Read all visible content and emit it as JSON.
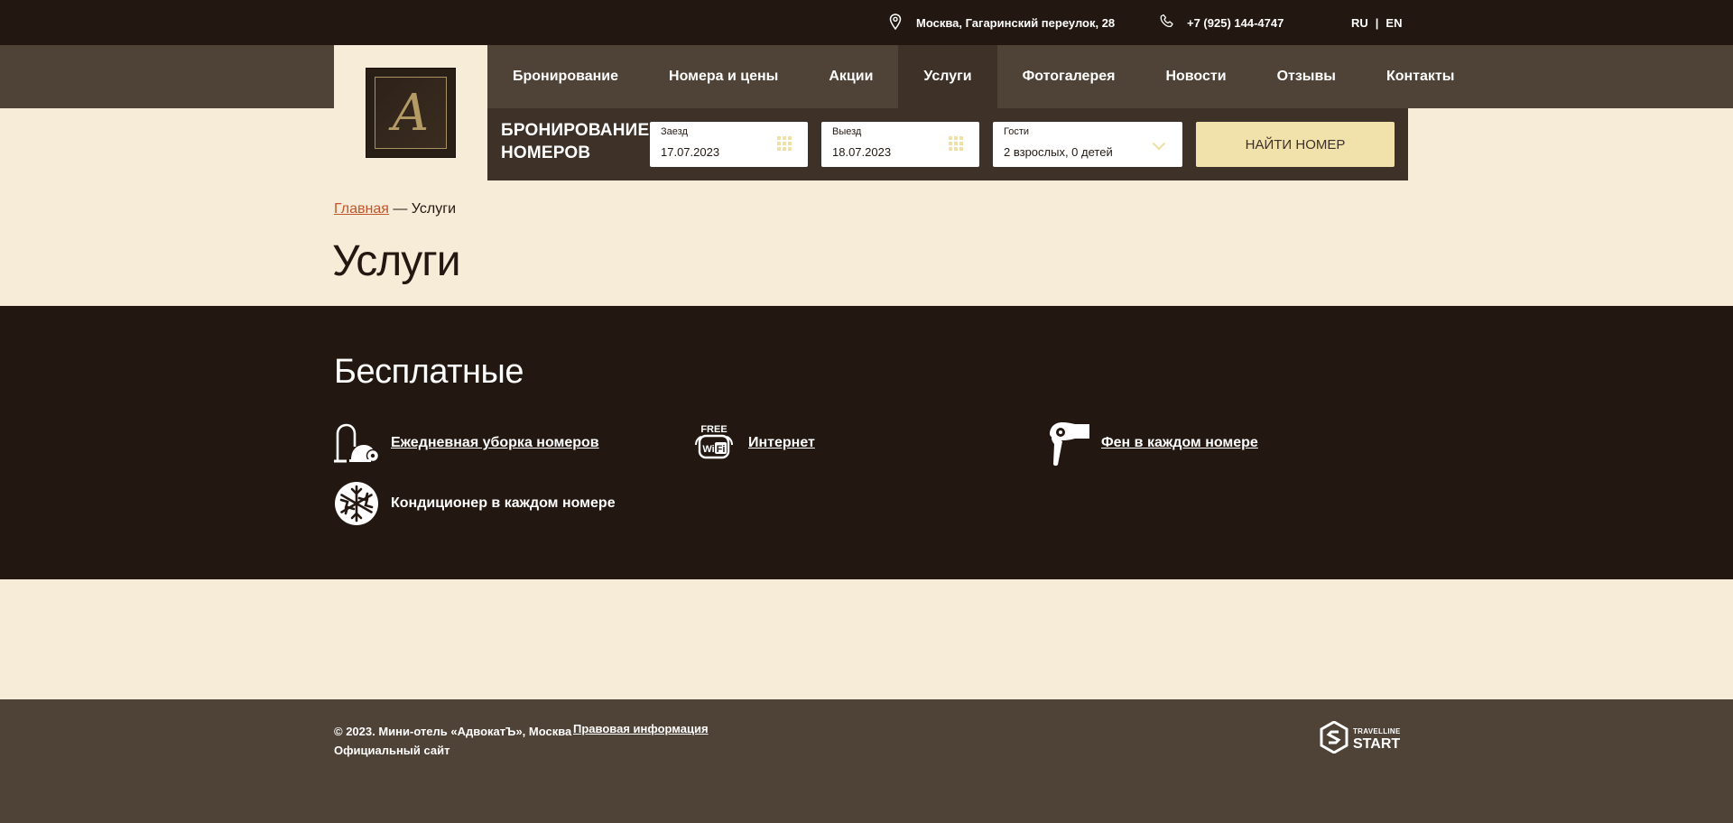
{
  "topbar": {
    "address": "Москва, Гагаринский переулок, 28",
    "phone": "+7 (925) 144-4747",
    "lang_ru": "RU",
    "lang_sep": "|",
    "lang_en": "EN"
  },
  "logo": {
    "letter": "А"
  },
  "nav": {
    "items": [
      {
        "label": "Бронирование"
      },
      {
        "label": "Номера и цены"
      },
      {
        "label": "Акции"
      },
      {
        "label": "Услуги",
        "active": true
      },
      {
        "label": "Фотогалерея"
      },
      {
        "label": "Новости"
      },
      {
        "label": "Отзывы"
      },
      {
        "label": "Контакты"
      }
    ]
  },
  "booking": {
    "title_line1": "БРОНИРОВАНИЕ",
    "title_line2": "НОМЕРОВ",
    "checkin_label": "Заезд",
    "checkin_value": "17.07.2023",
    "checkout_label": "Выезд",
    "checkout_value": "18.07.2023",
    "guests_label": "Гости",
    "guests_value": "2 взрослых, 0 детей",
    "find_button": "НАЙТИ НОМЕР"
  },
  "breadcrumb": {
    "home": "Главная",
    "separator": " — ",
    "current": "Услуги"
  },
  "page_title": "Услуги",
  "services": {
    "heading": "Бесплатные",
    "items": [
      {
        "label": "Ежедневная уборка номеров",
        "icon": "vacuum-cleaner-icon",
        "link": true
      },
      {
        "label": "Интернет",
        "icon": "free-wifi-icon",
        "link": true
      },
      {
        "label": "Фен в каждом номере",
        "icon": "hair-dryer-icon",
        "link": true
      },
      {
        "label": "Кондиционер в каждом номере",
        "icon": "snowflake-icon",
        "link": false
      }
    ],
    "wifi_badge_top": "FREE",
    "wifi_badge_bottom": "WiFi"
  },
  "footer": {
    "copyright": "© 2023. Мини-отель «АдвокатЪ», Москва",
    "official": "Официальный сайт",
    "legal_link": "Правовая информация",
    "travelline_small": "TRAVELLINE",
    "travelline_big": "START"
  },
  "colors": {
    "dark_brown": "#231811",
    "mid_brown": "#4f4236",
    "panel_brown": "#3e3127",
    "cream": "#f7ecd8",
    "button_gold": "#f1e1aa",
    "link_orange": "#c4552b"
  }
}
